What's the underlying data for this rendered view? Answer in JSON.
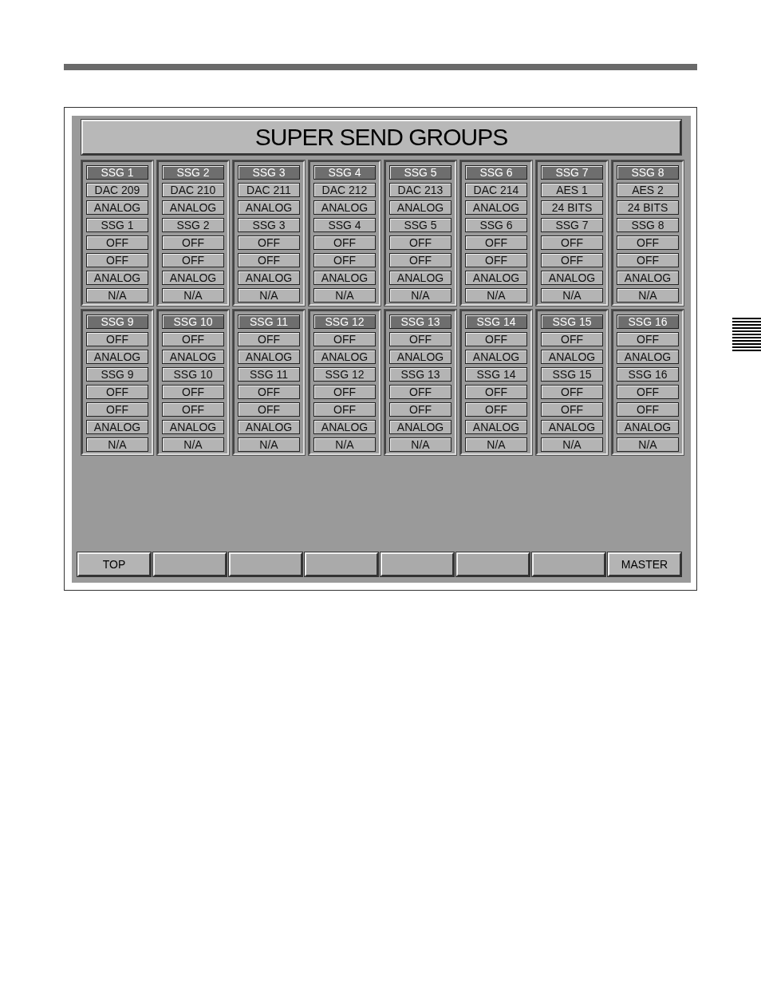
{
  "title": "SUPER SEND GROUPS",
  "groups": [
    {
      "header": "SSG 1",
      "values": [
        "DAC 209",
        "ANALOG",
        "SSG 1",
        "OFF",
        "OFF",
        "ANALOG",
        "N/A"
      ]
    },
    {
      "header": "SSG 2",
      "values": [
        "DAC 210",
        "ANALOG",
        "SSG 2",
        "OFF",
        "OFF",
        "ANALOG",
        "N/A"
      ]
    },
    {
      "header": "SSG 3",
      "values": [
        "DAC 211",
        "ANALOG",
        "SSG 3",
        "OFF",
        "OFF",
        "ANALOG",
        "N/A"
      ]
    },
    {
      "header": "SSG 4",
      "values": [
        "DAC 212",
        "ANALOG",
        "SSG 4",
        "OFF",
        "OFF",
        "ANALOG",
        "N/A"
      ]
    },
    {
      "header": "SSG 5",
      "values": [
        "DAC 213",
        "ANALOG",
        "SSG 5",
        "OFF",
        "OFF",
        "ANALOG",
        "N/A"
      ]
    },
    {
      "header": "SSG 6",
      "values": [
        "DAC 214",
        "ANALOG",
        "SSG 6",
        "OFF",
        "OFF",
        "ANALOG",
        "N/A"
      ]
    },
    {
      "header": "SSG 7",
      "values": [
        "AES 1",
        "24 BITS",
        "SSG 7",
        "OFF",
        "OFF",
        "ANALOG",
        "N/A"
      ]
    },
    {
      "header": "SSG 8",
      "values": [
        "AES 2",
        "24 BITS",
        "SSG 8",
        "OFF",
        "OFF",
        "ANALOG",
        "N/A"
      ]
    },
    {
      "header": "SSG 9",
      "values": [
        "OFF",
        "ANALOG",
        "SSG 9",
        "OFF",
        "OFF",
        "ANALOG",
        "N/A"
      ]
    },
    {
      "header": "SSG 10",
      "values": [
        "OFF",
        "ANALOG",
        "SSG 10",
        "OFF",
        "OFF",
        "ANALOG",
        "N/A"
      ]
    },
    {
      "header": "SSG 11",
      "values": [
        "OFF",
        "ANALOG",
        "SSG 11",
        "OFF",
        "OFF",
        "ANALOG",
        "N/A"
      ]
    },
    {
      "header": "SSG 12",
      "values": [
        "OFF",
        "ANALOG",
        "SSG 12",
        "OFF",
        "OFF",
        "ANALOG",
        "N/A"
      ]
    },
    {
      "header": "SSG 13",
      "values": [
        "OFF",
        "ANALOG",
        "SSG 13",
        "OFF",
        "OFF",
        "ANALOG",
        "N/A"
      ]
    },
    {
      "header": "SSG 14",
      "values": [
        "OFF",
        "ANALOG",
        "SSG 14",
        "OFF",
        "OFF",
        "ANALOG",
        "N/A"
      ]
    },
    {
      "header": "SSG 15",
      "values": [
        "OFF",
        "ANALOG",
        "SSG 15",
        "OFF",
        "OFF",
        "ANALOG",
        "N/A"
      ]
    },
    {
      "header": "SSG 16",
      "values": [
        "OFF",
        "ANALOG",
        "SSG 16",
        "OFF",
        "OFF",
        "ANALOG",
        "N/A"
      ]
    }
  ],
  "footer_buttons": [
    {
      "kind": "labeled",
      "label": "TOP"
    },
    {
      "kind": "blank"
    },
    {
      "kind": "blank"
    },
    {
      "kind": "blank"
    },
    {
      "kind": "blank"
    },
    {
      "kind": "blank"
    },
    {
      "kind": "blank"
    },
    {
      "kind": "labeled",
      "label": "MASTER"
    }
  ]
}
